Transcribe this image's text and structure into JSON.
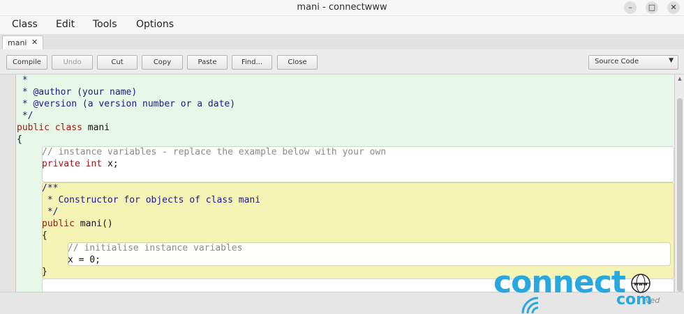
{
  "window": {
    "title": "mani - connectwww",
    "minimize": "–",
    "maximize": "□",
    "close": "✕"
  },
  "menu": [
    "Class",
    "Edit",
    "Tools",
    "Options"
  ],
  "tab": {
    "label": "mani",
    "close": "✕"
  },
  "toolbar": {
    "compile": "Compile",
    "undo": "Undo",
    "cut": "Cut",
    "copy": "Copy",
    "paste": "Paste",
    "find": "Find...",
    "close": "Close",
    "view_select": "Source Code"
  },
  "code": {
    "l1": " *",
    "l2": " * @author (your name)",
    "l3": " * @version (a version number or a date)",
    "l4": " */",
    "l5_kw1": "public",
    "l5_kw2": "class",
    "l5_txt": "mani",
    "l6": "{",
    "l7": "// instance variables - replace the example below with your own",
    "l8_kw1": "private",
    "l8_kw2": "int",
    "l8_txt": "x;",
    "l9": "/**",
    "l10": " * Constructor for objects of class mani",
    "l11": " */",
    "l12_kw": "public",
    "l12_txt": "mani()",
    "l13": "{",
    "l14": "// initialise instance variables",
    "l15": "x = 0;",
    "l16": "}"
  },
  "status": {
    "text": "ved"
  },
  "watermark": {
    "main": "connect",
    "sub": "com",
    "globe_text": "www"
  },
  "colors": {
    "editor_bg": "#e8f8e8",
    "method_scope": "#f6f4b4",
    "keyword": "#a01818",
    "comment": "#1a1a8c",
    "logo": "#29a8e0"
  }
}
